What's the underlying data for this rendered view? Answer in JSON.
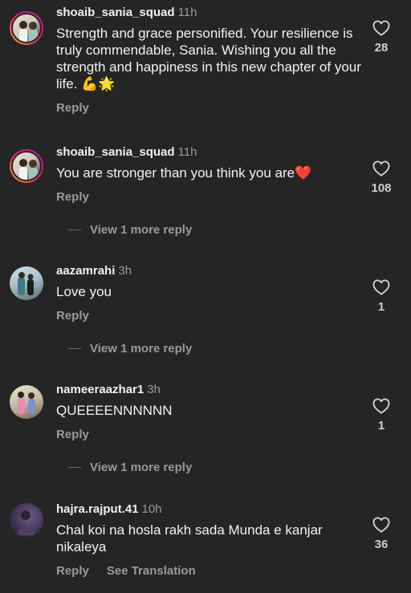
{
  "comments": [
    {
      "username": "shoaib_sania_squad",
      "time": "11h",
      "text": "Strength and grace personified. Your resilience is truly commendable, Sania. Wishing you all the strength and happiness in this new chapter of your life. 💪🌟",
      "likes": "28",
      "reply_label": "Reply"
    },
    {
      "username": "shoaib_sania_squad",
      "time": "11h",
      "text": "You are stronger than you think you are❤️",
      "likes": "108",
      "reply_label": "Reply",
      "view_more": "View 1 more reply"
    },
    {
      "username": "aazamrahi",
      "time": "3h",
      "text": "Love you",
      "likes": "1",
      "reply_label": "Reply",
      "view_more": "View 1 more reply"
    },
    {
      "username": "nameeraazhar1",
      "time": "3h",
      "text": "QUEEEENNNNNN",
      "likes": "1",
      "reply_label": "Reply",
      "view_more": "View 1 more reply"
    },
    {
      "username": "hajra.rajput.41",
      "time": "10h",
      "text": "Chal koi na hosla rakh sada Munda e kanjar nikaleya",
      "likes": "36",
      "reply_label": "Reply",
      "translate_label": "See Translation"
    }
  ],
  "icons": {
    "like": "heart-outline-icon"
  },
  "colors": {
    "background": "#252525",
    "secondary_text": "#9a9a9a",
    "story_ring_start": "#f9a825",
    "story_ring_end": "#9c27b0"
  }
}
